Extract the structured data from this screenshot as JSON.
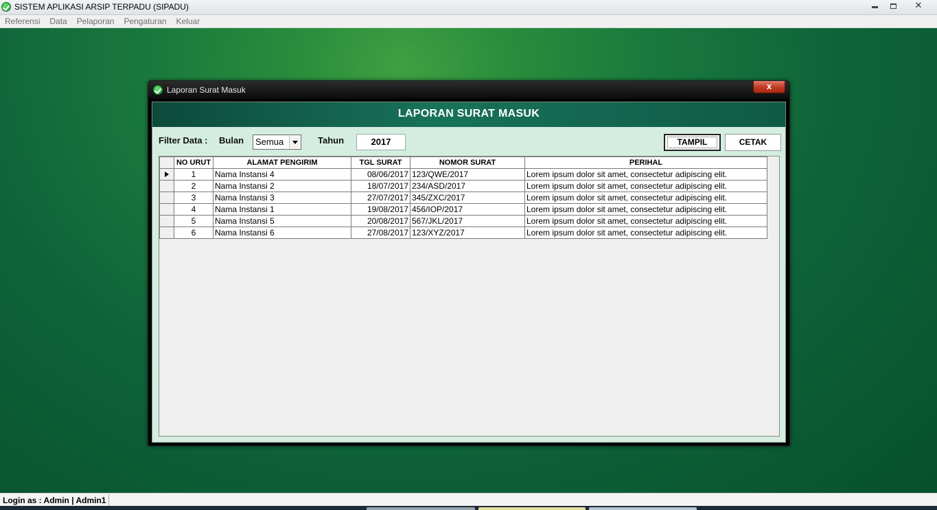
{
  "app": {
    "title": "SISTEM APLIKASI ARSIP TERPADU (SIPADU)",
    "icon": "check-circle-icon"
  },
  "menu": {
    "items": [
      "Referensi",
      "Data",
      "Pelaporan",
      "Pengaturan",
      "Keluar"
    ]
  },
  "dialog": {
    "window_title": "Laporan Surat Masuk",
    "close_label": "x",
    "header": "LAPORAN SURAT MASUK",
    "filter": {
      "label": "Filter Data :",
      "bulan_label": "Bulan",
      "bulan_value": "Semua",
      "tahun_label": "Tahun",
      "tahun_value": "2017"
    },
    "buttons": {
      "tampil": "TAMPIL",
      "cetak": "CETAK"
    },
    "table": {
      "columns": [
        "NO URUT",
        "ALAMAT PENGIRIM",
        "TGL SURAT",
        "NOMOR SURAT",
        "PERIHAL"
      ],
      "rows": [
        [
          "1",
          "Nama Instansi 4",
          "08/06/2017",
          "123/QWE/2017",
          "Lorem ipsum dolor sit amet, consectetur adipiscing elit."
        ],
        [
          "2",
          "Nama Instansi 2",
          "18/07/2017",
          "234/ASD/2017",
          "Lorem ipsum dolor sit amet, consectetur adipiscing elit."
        ],
        [
          "3",
          "Nama Instansi 3",
          "27/07/2017",
          "345/ZXC/2017",
          "Lorem ipsum dolor sit amet, consectetur adipiscing elit."
        ],
        [
          "4",
          "Nama Instansi 1",
          "19/08/2017",
          "456/IOP/2017",
          "Lorem ipsum dolor sit amet, consectetur adipiscing elit."
        ],
        [
          "5",
          "Nama Instansi 5",
          "20/08/2017",
          "567/JKL/2017",
          "Lorem ipsum dolor sit amet, consectetur adipiscing elit."
        ],
        [
          "6",
          "Nama Instansi 6",
          "27/08/2017",
          "123/XYZ/2017",
          "Lorem ipsum dolor sit amet, consectetur adipiscing elit."
        ]
      ]
    }
  },
  "status": {
    "login": "Login as : Admin  |  Admin1"
  },
  "colors": {
    "desktop": "#1a7a3d",
    "header": "#18725a",
    "dialog_body": "#d4ede0"
  }
}
